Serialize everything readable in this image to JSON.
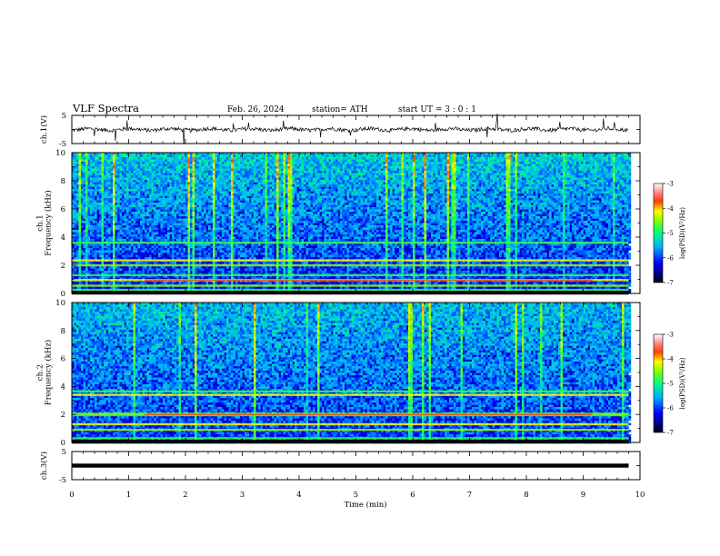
{
  "header": {
    "title": "VLF  Spectra",
    "date": "Feb. 26, 2024",
    "station": "station= ATH",
    "start": "start  UT  =    3  : 0   : 1"
  },
  "chart_data": [
    {
      "type": "line",
      "id": "ch1-voltage",
      "ylabel": "ch.1(V)",
      "ylim": [
        -5,
        5
      ],
      "yticks": [
        "5",
        "-5"
      ],
      "xlim": [
        0,
        10
      ],
      "trace_level": 0.0
    },
    {
      "type": "heatmap",
      "id": "ch1-spectrogram",
      "ylabel": "ch.1\nFrequency (kHz)",
      "ylim": [
        0,
        10
      ],
      "yticks": [
        "0",
        "2",
        "4",
        "6",
        "8",
        "10"
      ],
      "xlim": [
        0,
        10
      ],
      "data_extent_min": 9.8,
      "colorbar": {
        "label": "log(PSD)(V²/Hz)",
        "range": [
          -7,
          -3
        ],
        "ticks": [
          "-3",
          "-4",
          "-5",
          "-6",
          "-7"
        ]
      },
      "bands_khz": [
        0.25,
        0.55,
        0.95,
        1.3,
        2.0,
        2.35,
        3.6
      ]
    },
    {
      "type": "heatmap",
      "id": "ch2-spectrogram",
      "ylabel": "ch.2\nFrequency (kHz)",
      "ylim": [
        0,
        10
      ],
      "yticks": [
        "0",
        "2",
        "4",
        "6",
        "8",
        "10"
      ],
      "xlim": [
        0,
        10
      ],
      "data_extent_min": 9.8,
      "colorbar": {
        "label": "log(PSD)(V²/Hz)",
        "range": [
          -7,
          -3
        ],
        "ticks": [
          "-3",
          "-4",
          "-5",
          "-6",
          "-7"
        ]
      },
      "bands_khz": [
        0.3,
        0.9,
        1.3,
        1.95,
        2.05,
        3.4,
        3.65
      ]
    },
    {
      "type": "line",
      "id": "ch3-voltage",
      "ylabel": "ch.3(V)",
      "ylim": [
        -5,
        5
      ],
      "yticks": [
        "5",
        "-5"
      ],
      "xlim": [
        0,
        10
      ],
      "trace_level": 0.0
    }
  ],
  "xaxis": {
    "label": "Time  (min)",
    "ticks": [
      "0",
      "1",
      "2",
      "3",
      "4",
      "5",
      "6",
      "7",
      "8",
      "9",
      "10"
    ]
  },
  "colors": {
    "axis": "#000000",
    "background": "#ffffff",
    "trace": "#000000"
  }
}
